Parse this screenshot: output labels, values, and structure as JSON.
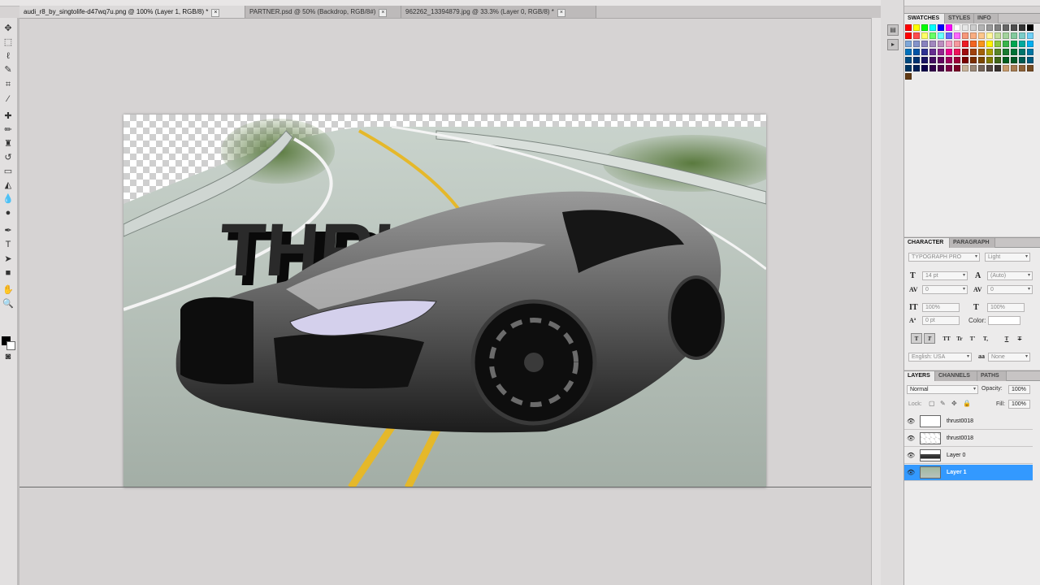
{
  "tabs": [
    {
      "label": "audi_r8_by_singtolife-d47wq7u.png @ 100% (Layer 1, RGB/8) *",
      "close": "×",
      "active": true
    },
    {
      "label": "PARTNER.psd @ 50% (Backdrop, RGB/8#)",
      "close": "×",
      "active": false
    },
    {
      "label": "962262_13394879.jpg @ 33.3% (Layer 0, RGB/8) *",
      "close": "×",
      "active": false
    }
  ],
  "canvas": {
    "overlay_text": "THRUST"
  },
  "swatches_panel": {
    "tabs": [
      "SWATCHES",
      "STYLES",
      "INFO"
    ],
    "colors": [
      "#ff0000",
      "#ffff00",
      "#00ff00",
      "#00ffff",
      "#0000ff",
      "#ff00ff",
      "#ffffff",
      "#e6e6e6",
      "#cccccc",
      "#b3b3b3",
      "#999999",
      "#808080",
      "#666666",
      "#4d4d4d",
      "#333333",
      "#000000",
      "#ff0000",
      "#ff4d4d",
      "#ffff66",
      "#66ff66",
      "#66ffff",
      "#6666ff",
      "#ff66ff",
      "#f7977a",
      "#f9ad81",
      "#fdc68a",
      "#fff79a",
      "#c4df9b",
      "#a3d39c",
      "#82ca9d",
      "#7bcdc8",
      "#6ecff6",
      "#7ea7d8",
      "#8493ca",
      "#8882be",
      "#a187be",
      "#bc8dbf",
      "#f49ac2",
      "#f6989d",
      "#ed1c24",
      "#f26522",
      "#f7941d",
      "#fff200",
      "#8dc73f",
      "#39b54a",
      "#00a651",
      "#00a99d",
      "#00aeef",
      "#0072bc",
      "#0054a6",
      "#2e3192",
      "#662d91",
      "#92278f",
      "#ec008c",
      "#ed145b",
      "#9e0b0f",
      "#a0410d",
      "#a3620a",
      "#aba000",
      "#598527",
      "#197b30",
      "#007236",
      "#00746b",
      "#0076a3",
      "#004a80",
      "#003471",
      "#1b1464",
      "#440e62",
      "#630460",
      "#9e005d",
      "#9e0039",
      "#790000",
      "#7b2e00",
      "#7d4900",
      "#827b00",
      "#406618",
      "#005e20",
      "#005826",
      "#005952",
      "#005b7f",
      "#003663",
      "#002157",
      "#0d004c",
      "#32004b",
      "#4b0049",
      "#7b0046",
      "#7a0026",
      "#c7b299",
      "#998675",
      "#736357",
      "#534741",
      "#37302d",
      "#c69c6d",
      "#a67c52",
      "#8c6239",
      "#754c24",
      "#603913"
    ]
  },
  "character_panel": {
    "tabs": [
      "CHARACTER",
      "PARAGRAPH"
    ],
    "font_family": "TYPOGRAPH PRO",
    "font_style": "Light",
    "font_size": "14 pt",
    "leading": "(Auto)",
    "kerning": "0",
    "tracking": "0",
    "vertical_scale": "100%",
    "horizontal_scale": "100%",
    "baseline_shift": "0 pt",
    "color_label": "Color:",
    "style_buttons": [
      "T",
      "T",
      "TT",
      "Tr",
      "T'",
      "T,",
      "T",
      "T"
    ],
    "language": "English: USA",
    "antialias": "None",
    "aa_label": "a"
  },
  "layers_panel": {
    "tabs": [
      "LAYERS",
      "CHANNELS",
      "PATHS"
    ],
    "blend_mode": "Normal",
    "opacity_label": "Opacity:",
    "opacity": "100%",
    "lock_label": "Lock:",
    "fill_label": "Fill:",
    "fill": "100%",
    "layers": [
      {
        "name": "thrust0018",
        "selected": false
      },
      {
        "name": "thrust0018",
        "selected": false
      },
      {
        "name": "Layer 0",
        "selected": false
      },
      {
        "name": "Layer 1",
        "selected": true
      }
    ]
  },
  "accent_color": "#3399ff"
}
